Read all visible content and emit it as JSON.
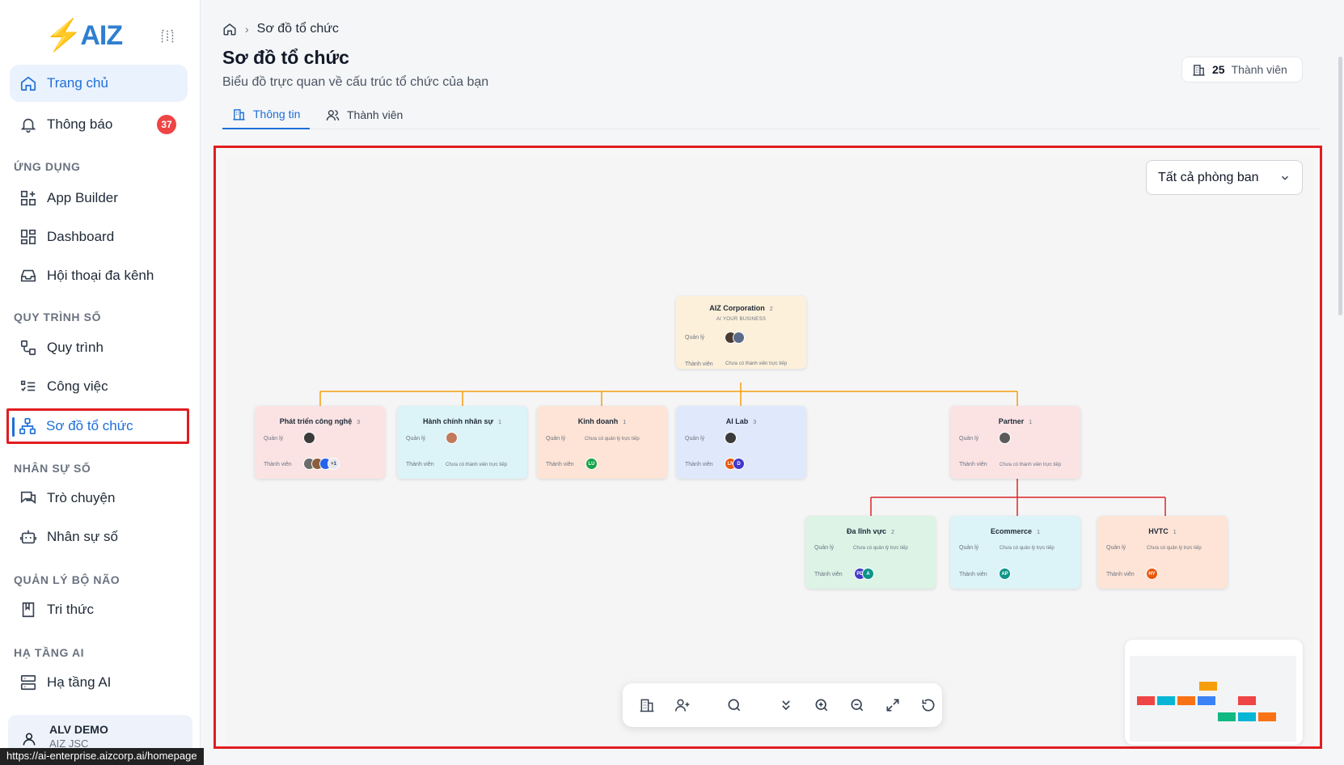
{
  "sidebar": {
    "logo": "AIZ",
    "items": {
      "home": "Trang chủ",
      "notifications": "Thông báo",
      "notifications_badge": "37",
      "app_builder": "App Builder",
      "dashboard": "Dashboard",
      "omnichannel": "Hội thoại đa kênh",
      "process": "Quy trình",
      "tasks": "Công việc",
      "org_chart": "Sơ đồ tổ chức",
      "chat": "Trò chuyện",
      "digital_staff": "Nhân sự số",
      "knowledge": "Tri thức",
      "ai_infra": "Hạ tầng AI"
    },
    "sections": {
      "apps": "ỨNG DỤNG",
      "digital_process": "QUY TRÌNH SỐ",
      "digital_hr": "NHÂN SỰ SỐ",
      "brain": "QUẢN LÝ BỘ NÃO",
      "ai_infra": "HẠ TẦNG AI"
    },
    "user": {
      "name": "ALV DEMO",
      "company": "AIZ JSC"
    }
  },
  "status_url": "https://ai-enterprise.aizcorp.ai/homepage",
  "header": {
    "breadcrumb": "Sơ đồ tổ chức",
    "title": "Sơ đồ tổ chức",
    "subtitle": "Biểu đồ trực quan về cấu trúc tổ chức của bạn",
    "member_count": "25",
    "member_label": "Thành viên"
  },
  "tabs": {
    "info": "Thông tin",
    "members": "Thành viên"
  },
  "filter": {
    "selected": "Tất cả phòng ban"
  },
  "labels": {
    "manager": "Quản lý",
    "member": "Thành viên",
    "no_member": "Chưa có thành viên trực tiếp",
    "no_manager": "Chưa có quản lý trực tiếp"
  },
  "nodes": {
    "root": {
      "name": "AIZ Corporation",
      "count": "2",
      "tagline": "AI YOUR BUSINESS"
    },
    "tech": {
      "name": "Phát triển công nghệ",
      "count": "3",
      "more": "+1"
    },
    "hr": {
      "name": "Hành chính nhân sự",
      "count": "1"
    },
    "sales": {
      "name": "Kinh doanh",
      "count": "1",
      "m1": "LU"
    },
    "ailab": {
      "name": "AI Lab",
      "count": "3",
      "m1": "LN",
      "m2": "D"
    },
    "partner": {
      "name": "Partner",
      "count": "1"
    },
    "multi": {
      "name": "Đa lĩnh vực",
      "count": "2",
      "m1": "PD",
      "m2": "A"
    },
    "ecom": {
      "name": "Ecommerce",
      "count": "1",
      "m1": "AP"
    },
    "hvtc": {
      "name": "HVTC",
      "count": "1",
      "m1": "HY"
    }
  },
  "colors": {
    "accent": "#1d6fd8",
    "highlight": "#e11d20",
    "line_top": "#f59e0b",
    "line_partner": "#dc2626"
  }
}
